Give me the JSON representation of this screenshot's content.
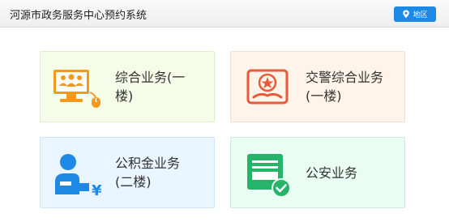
{
  "header": {
    "title": "河源市政务服务中心预约系统",
    "region_button": "地区",
    "region_icon": "location-pin-icon"
  },
  "services": [
    {
      "label": "综合业务(一\n楼)",
      "icon": "computer-users-icon",
      "color": "#f39a1c",
      "bg": "#f5fde8"
    },
    {
      "label": "交警综合业务\n(一楼)",
      "icon": "police-badge-icon",
      "color": "#e85a3a",
      "bg": "#fff4ea"
    },
    {
      "label": "公积金业务\n(二楼)",
      "icon": "person-yuan-icon",
      "color": "#1e88e5",
      "bg": "#e9f5ff"
    },
    {
      "label": "公安业务",
      "icon": "security-document-check-icon",
      "color": "#27b36a",
      "bg": "#e9fdf3"
    }
  ]
}
